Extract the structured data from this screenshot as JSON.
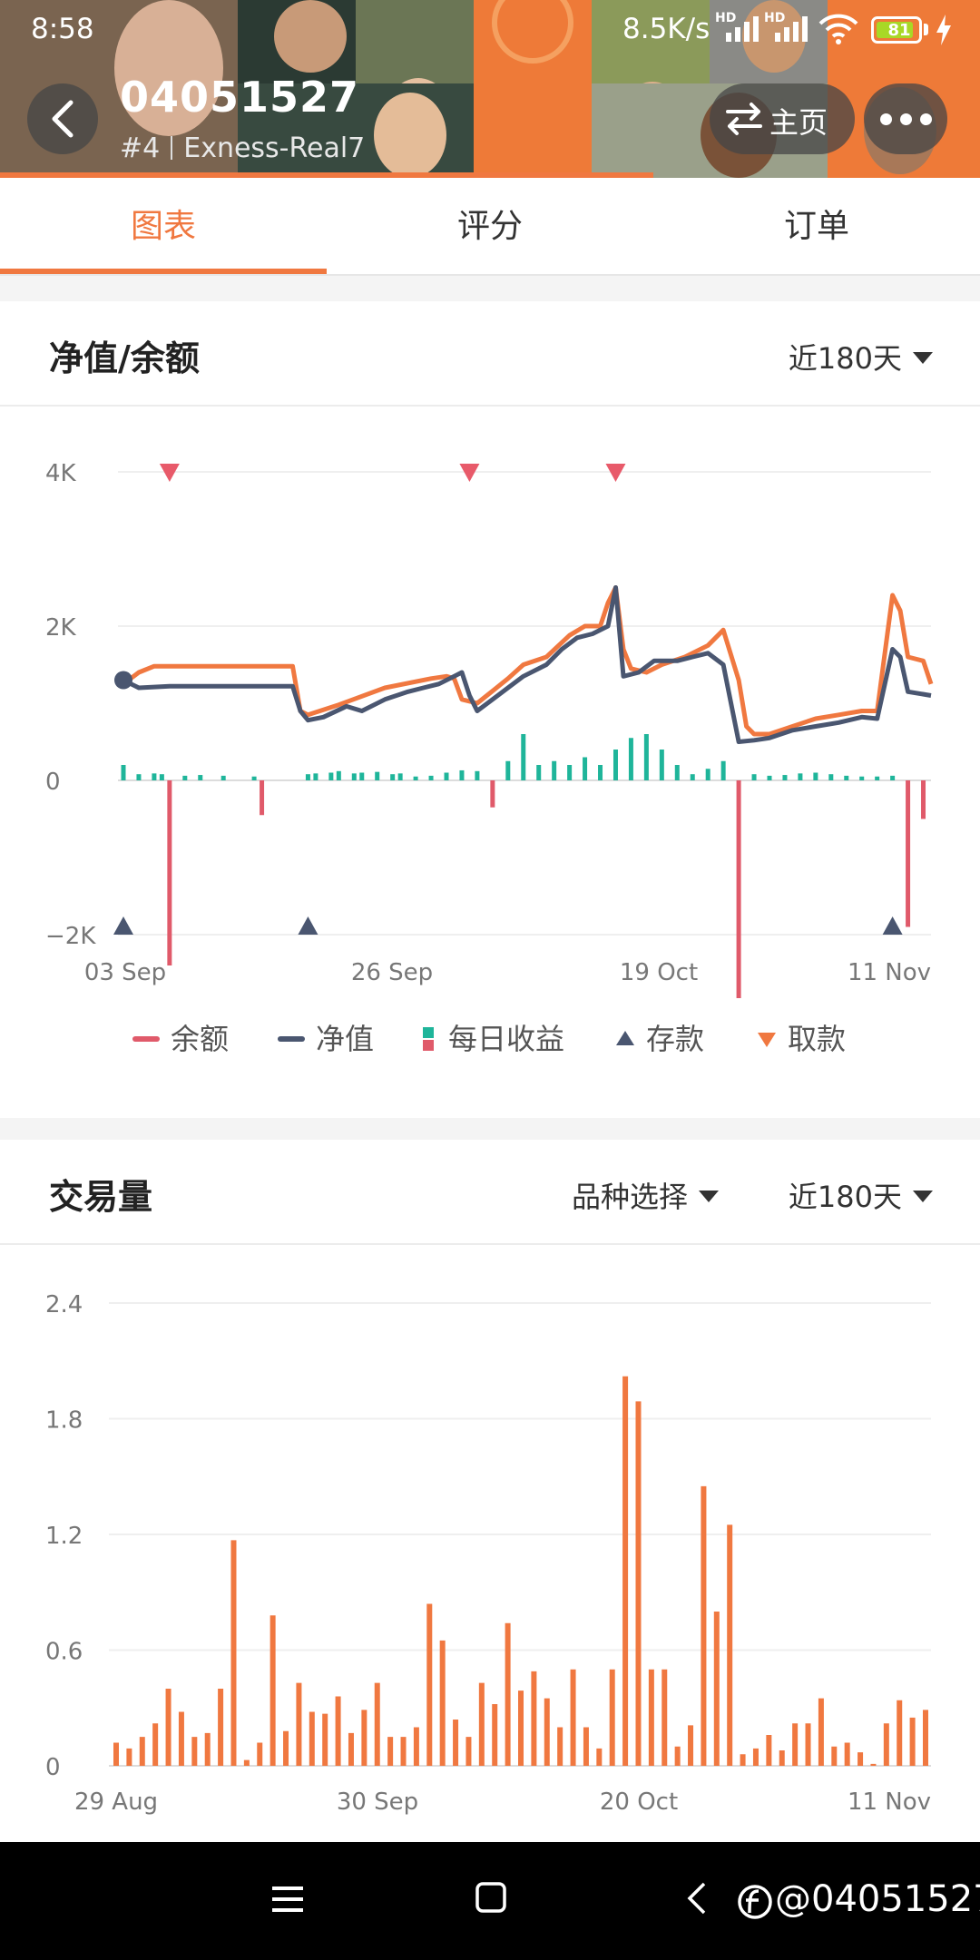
{
  "status_bar": {
    "time": "8:58",
    "speed": "8.5K/s",
    "hd1": "HD",
    "hd2": "HD",
    "battery": "81"
  },
  "header": {
    "account": "04051527",
    "rank": "#4",
    "server": "Exness-Real7",
    "home_label": "主页"
  },
  "tabs": [
    {
      "label": "图表",
      "active": true
    },
    {
      "label": "评分",
      "active": false
    },
    {
      "label": "订单",
      "active": false
    }
  ],
  "equity_card": {
    "title": "净值/余额",
    "period": "近180天",
    "y_ticks": [
      "4K",
      "2K",
      "0",
      "−2K"
    ],
    "x_ticks": [
      "03 Sep",
      "26 Sep",
      "19 Oct",
      "11 Nov"
    ],
    "legend": [
      {
        "label": "余额",
        "color": "#e05a6a",
        "icon": "line"
      },
      {
        "label": "净值",
        "color": "#4a5670",
        "icon": "line"
      },
      {
        "label": "每日收益",
        "color": "#1fb59a",
        "color2": "#e05a6a",
        "icon": "bars"
      },
      {
        "label": "存款",
        "color": "#4a5670",
        "icon": "triangle-up"
      },
      {
        "label": "取款",
        "color": "#f07840",
        "icon": "triangle-down"
      }
    ]
  },
  "volume_card": {
    "title": "交易量",
    "symbol_select": "品种选择",
    "period": "近180天",
    "y_ticks": [
      "2.4",
      "1.8",
      "1.2",
      "0.6",
      "0"
    ],
    "x_ticks": [
      "29 Aug",
      "30 Sep",
      "20 Oct",
      "11 Nov"
    ]
  },
  "chart_data": [
    {
      "type": "line",
      "title": "净值/余额",
      "ylim": [
        -2000,
        4000
      ],
      "x_ticks": [
        "03 Sep",
        "26 Sep",
        "19 Oct",
        "11 Nov"
      ],
      "series": [
        {
          "name": "余额",
          "color": "#f07840",
          "points": [
            [
              0,
              1250
            ],
            [
              2,
              1400
            ],
            [
              4,
              1480
            ],
            [
              10,
              1480
            ],
            [
              20,
              1480
            ],
            [
              22,
              1480
            ],
            [
              23,
              900
            ],
            [
              24,
              850
            ],
            [
              28,
              980
            ],
            [
              34,
              1200
            ],
            [
              40,
              1320
            ],
            [
              42,
              1350
            ],
            [
              43,
              1320
            ],
            [
              44,
              1050
            ],
            [
              46,
              1000
            ],
            [
              48,
              1160
            ],
            [
              50,
              1320
            ],
            [
              52,
              1500
            ],
            [
              55,
              1600
            ],
            [
              58,
              1880
            ],
            [
              60,
              2000
            ],
            [
              62,
              2000
            ],
            [
              63,
              2300
            ],
            [
              64,
              2500
            ],
            [
              65,
              1700
            ],
            [
              66,
              1450
            ],
            [
              68,
              1400
            ],
            [
              70,
              1500
            ],
            [
              73,
              1600
            ],
            [
              76,
              1750
            ],
            [
              78,
              1950
            ],
            [
              80,
              1300
            ],
            [
              81,
              700
            ],
            [
              82,
              600
            ],
            [
              84,
              600
            ],
            [
              87,
              700
            ],
            [
              90,
              800
            ],
            [
              93,
              850
            ],
            [
              96,
              900
            ],
            [
              98,
              900
            ],
            [
              100,
              2400
            ],
            [
              101,
              2200
            ],
            [
              102,
              1600
            ],
            [
              104,
              1550
            ],
            [
              105,
              1250
            ]
          ]
        },
        {
          "name": "净值",
          "color": "#4a5670",
          "points": [
            [
              0,
              1300
            ],
            [
              1,
              1250
            ],
            [
              2,
              1200
            ],
            [
              6,
              1220
            ],
            [
              10,
              1220
            ],
            [
              20,
              1220
            ],
            [
              22,
              1220
            ],
            [
              23,
              900
            ],
            [
              24,
              780
            ],
            [
              26,
              820
            ],
            [
              29,
              960
            ],
            [
              31,
              900
            ],
            [
              34,
              1050
            ],
            [
              37,
              1150
            ],
            [
              39,
              1200
            ],
            [
              41,
              1250
            ],
            [
              43,
              1350
            ],
            [
              44,
              1400
            ],
            [
              45,
              1100
            ],
            [
              46,
              900
            ],
            [
              48,
              1050
            ],
            [
              50,
              1200
            ],
            [
              52,
              1350
            ],
            [
              55,
              1500
            ],
            [
              57,
              1700
            ],
            [
              59,
              1850
            ],
            [
              61,
              1900
            ],
            [
              63,
              2000
            ],
            [
              64,
              2500
            ],
            [
              65,
              1350
            ],
            [
              67,
              1400
            ],
            [
              69,
              1550
            ],
            [
              72,
              1550
            ],
            [
              74,
              1600
            ],
            [
              76,
              1650
            ],
            [
              78,
              1500
            ],
            [
              79,
              1000
            ],
            [
              80,
              500
            ],
            [
              82,
              520
            ],
            [
              84,
              550
            ],
            [
              87,
              650
            ],
            [
              90,
              700
            ],
            [
              93,
              750
            ],
            [
              96,
              820
            ],
            [
              98,
              800
            ],
            [
              100,
              1700
            ],
            [
              101,
              1600
            ],
            [
              102,
              1150
            ],
            [
              105,
              1100
            ]
          ]
        }
      ],
      "daily_profit": [
        [
          0,
          200
        ],
        [
          2,
          80
        ],
        [
          4,
          90
        ],
        [
          5,
          80
        ],
        [
          6,
          -2400
        ],
        [
          8,
          60
        ],
        [
          10,
          70
        ],
        [
          13,
          60
        ],
        [
          17,
          50
        ],
        [
          18,
          -450
        ],
        [
          24,
          80
        ],
        [
          25,
          90
        ],
        [
          27,
          100
        ],
        [
          28,
          120
        ],
        [
          30,
          90
        ],
        [
          31,
          100
        ],
        [
          33,
          110
        ],
        [
          35,
          80
        ],
        [
          36,
          90
        ],
        [
          38,
          50
        ],
        [
          40,
          60
        ],
        [
          42,
          100
        ],
        [
          44,
          130
        ],
        [
          46,
          120
        ],
        [
          48,
          -350
        ],
        [
          50,
          250
        ],
        [
          52,
          600
        ],
        [
          54,
          200
        ],
        [
          56,
          250
        ],
        [
          58,
          200
        ],
        [
          60,
          300
        ],
        [
          62,
          200
        ],
        [
          64,
          400
        ],
        [
          66,
          550
        ],
        [
          68,
          600
        ],
        [
          70,
          400
        ],
        [
          72,
          200
        ],
        [
          74,
          80
        ],
        [
          76,
          150
        ],
        [
          78,
          250
        ],
        [
          80,
          -3000
        ],
        [
          82,
          80
        ],
        [
          84,
          60
        ],
        [
          86,
          70
        ],
        [
          88,
          90
        ],
        [
          90,
          100
        ],
        [
          92,
          80
        ],
        [
          94,
          60
        ],
        [
          96,
          50
        ],
        [
          98,
          50
        ],
        [
          100,
          60
        ],
        [
          102,
          -1900
        ],
        [
          104,
          -500
        ]
      ],
      "deposits": [
        [
          0,
          -2000
        ],
        [
          24,
          -2000
        ],
        [
          100,
          -2000
        ]
      ],
      "withdrawals": [
        [
          6,
          4000
        ],
        [
          45,
          4000
        ],
        [
          64,
          4000
        ]
      ]
    },
    {
      "type": "bar",
      "title": "交易量",
      "ylim": [
        0,
        2.4
      ],
      "x_ticks": [
        "29 Aug",
        "30 Sep",
        "20 Oct",
        "11 Nov"
      ],
      "series": [
        {
          "name": "交易量",
          "color": "#f07840",
          "values": [
            0.12,
            0.09,
            0.15,
            0.22,
            0.4,
            0.28,
            0.15,
            0.17,
            0.4,
            1.17,
            0.03,
            0.12,
            0.78,
            0.18,
            0.43,
            0.28,
            0.27,
            0.36,
            0.17,
            0.29,
            0.43,
            0.15,
            0.15,
            0.2,
            0.84,
            0.65,
            0.24,
            0.15,
            0.43,
            0.32,
            0.74,
            0.39,
            0.49,
            0.35,
            0.2,
            0.5,
            0.2,
            0.09,
            0.5,
            2.02,
            1.89,
            0.5,
            0.5,
            0.1,
            0.21,
            1.45,
            0.8,
            1.25,
            0.06,
            0.09,
            0.16,
            0.08,
            0.22,
            0.22,
            0.35,
            0.1,
            0.12,
            0.07,
            0.01,
            0.22,
            0.34,
            0.25,
            0.29
          ]
        }
      ]
    }
  ]
}
